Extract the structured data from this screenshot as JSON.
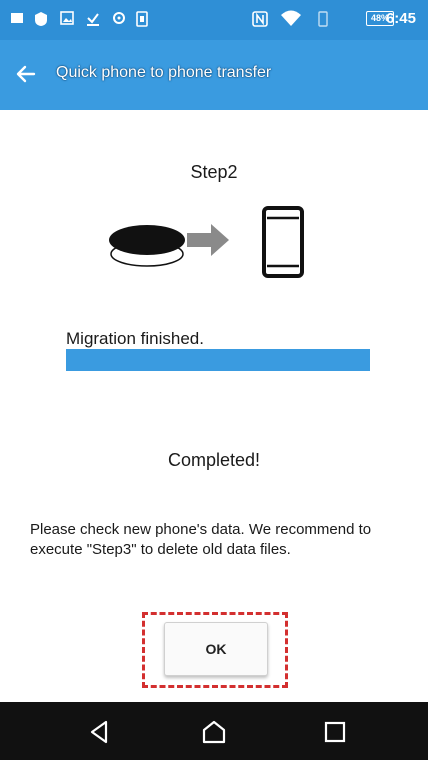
{
  "status_bar": {
    "time": "6:45",
    "battery": "48%",
    "icons": [
      "notification-icon",
      "shield-icon",
      "image-icon",
      "download-icon",
      "settings-icon",
      "sim-icon",
      "nfc-icon",
      "wifi-icon",
      "vibrate-icon",
      "battery-icon"
    ]
  },
  "app_bar": {
    "title": "Quick phone to phone transfer",
    "back_icon": "back-arrow-icon",
    "color": "#3a9be0"
  },
  "main": {
    "step_title": "Step2",
    "illustration": {
      "source_icon": "disc-icon",
      "arrow_icon": "arrow-right-icon",
      "target_icon": "phone-icon"
    },
    "status_text": "Migration finished.",
    "progress": 1.0,
    "completed_text": "Completed!",
    "message": "Please check new phone's data. We recommend to execute \"Step3\" to delete old data files.",
    "ok_label": "OK",
    "highlight_color": "#d32f2f"
  },
  "nav_bar": {
    "buttons": [
      "back-triangle-icon",
      "home-icon",
      "recents-icon"
    ]
  }
}
